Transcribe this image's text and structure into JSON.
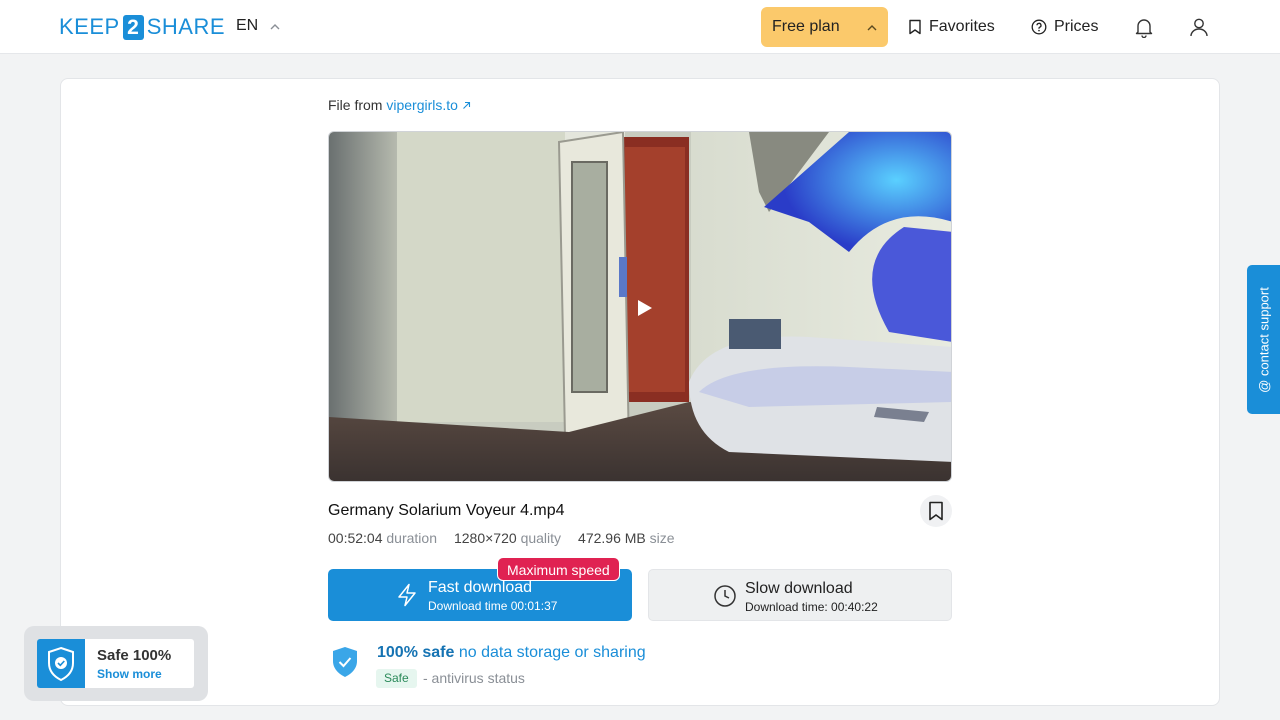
{
  "header": {
    "logo_left": "KEEP",
    "logo_mid": "2",
    "logo_right": "SHARE",
    "language": "EN",
    "plan_label": "Free plan",
    "favorites_label": "Favorites",
    "prices_label": "Prices"
  },
  "file": {
    "from_label": "File from",
    "source_link": "vipergirls.to",
    "title": "Germany Solarium Voyeur 4.mp4",
    "duration": "00:52:04",
    "duration_label": "duration",
    "resolution": "1280×720",
    "resolution_label": "quality",
    "size": "472.96 MB",
    "size_label": "size"
  },
  "download": {
    "fast_label": "Fast download",
    "fast_time": "Download time 00:01:37",
    "max_speed_badge": "Maximum speed",
    "slow_label": "Slow download",
    "slow_time": "Download time: 00:40:22"
  },
  "safety": {
    "headline_bold": "100% safe",
    "headline_rest": "no data storage or sharing",
    "badge": "Safe",
    "status_text": "- antivirus status"
  },
  "safe_widget": {
    "title": "Safe 100%",
    "link": "Show more"
  },
  "support_tab": {
    "label": "@ contact support"
  },
  "colors": {
    "brand_blue": "#1a8ed8",
    "plan_yellow": "#fbc96b",
    "badge_red": "#e02252"
  }
}
